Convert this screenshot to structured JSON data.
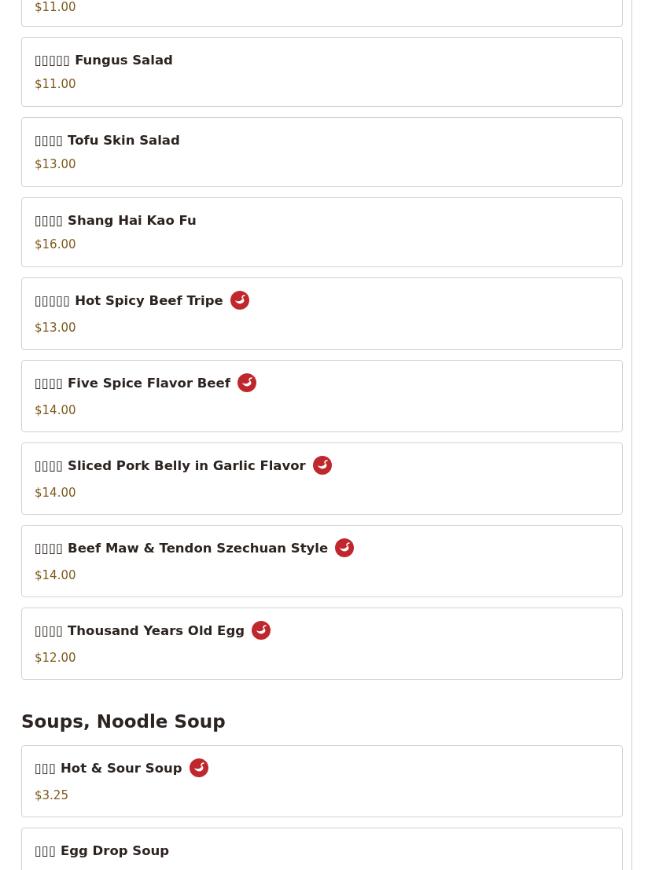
{
  "sections": [
    {
      "items": [
        {
          "price": "$11.00",
          "spicy": false
        },
        {
          "name": "▯▯▯▯▯ Fungus Salad",
          "price": "$11.00",
          "spicy": false
        },
        {
          "name": "▯▯▯▯ Tofu Skin Salad",
          "price": "$13.00",
          "spicy": false
        },
        {
          "name": "▯▯▯▯ Shang Hai Kao Fu",
          "price": "$16.00",
          "spicy": false
        },
        {
          "name": "▯▯▯▯▯ Hot Spicy Beef Tripe",
          "price": "$13.00",
          "spicy": true
        },
        {
          "name": "▯▯▯▯ Five Spice Flavor Beef",
          "price": "$14.00",
          "spicy": true
        },
        {
          "name": "▯▯▯▯ Sliced Pork Belly in Garlic Flavor",
          "price": "$14.00",
          "spicy": true
        },
        {
          "name": "▯▯▯▯ Beef Maw & Tendon Szechuan Style",
          "price": "$14.00",
          "spicy": true
        },
        {
          "name": "▯▯▯▯ Thousand Years Old Egg",
          "price": "$12.00",
          "spicy": true
        }
      ]
    },
    {
      "title": "Soups, Noodle Soup",
      "items": [
        {
          "name": "▯▯▯ Hot & Sour Soup",
          "price": "$3.25",
          "spicy": true
        },
        {
          "name": "▯▯▯ Egg Drop Soup",
          "spicy": false
        }
      ]
    }
  ]
}
